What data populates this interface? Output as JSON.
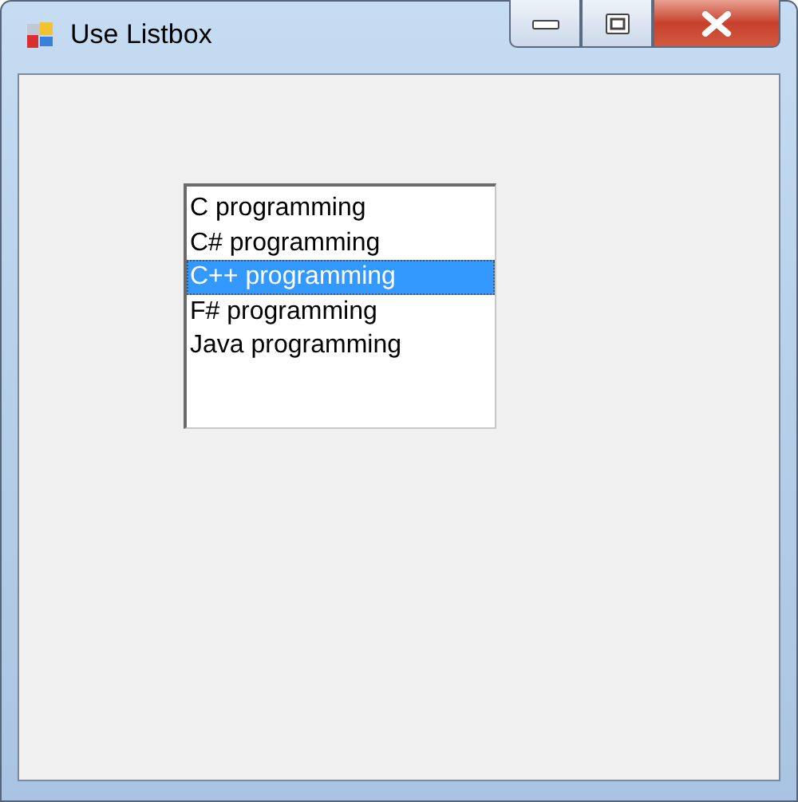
{
  "window": {
    "title": "Use Listbox"
  },
  "listbox": {
    "items": [
      {
        "label": "C programming",
        "selected": false
      },
      {
        "label": "C# programming",
        "selected": false
      },
      {
        "label": "C++ programming",
        "selected": true
      },
      {
        "label": "F# programming",
        "selected": false
      },
      {
        "label": "Java programming",
        "selected": false
      }
    ]
  }
}
